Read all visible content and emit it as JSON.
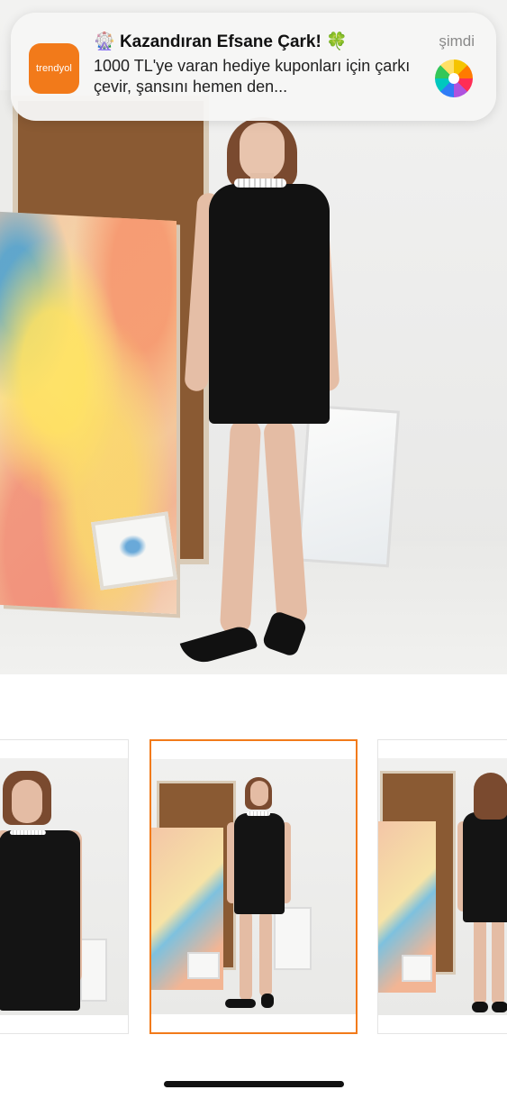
{
  "notification": {
    "app_icon_label": "trendyol",
    "title_emoji_left": "🎡",
    "title": "Kazandıran Efsane Çark!",
    "title_emoji_right": "🍀",
    "body": "1000 TL'ye varan hediye kuponları için çarkı çevir, şansını hemen den...",
    "time": "şimdi",
    "attachment_icon": "spin-wheel-icon"
  },
  "product_gallery": {
    "thumbnails": [
      {
        "view": "close-up front",
        "selected": false
      },
      {
        "view": "full-body front",
        "selected": true
      },
      {
        "view": "back",
        "selected": false
      }
    ]
  },
  "colors": {
    "brand_orange": "#f27a1a",
    "selected_border": "#f27a1a"
  }
}
